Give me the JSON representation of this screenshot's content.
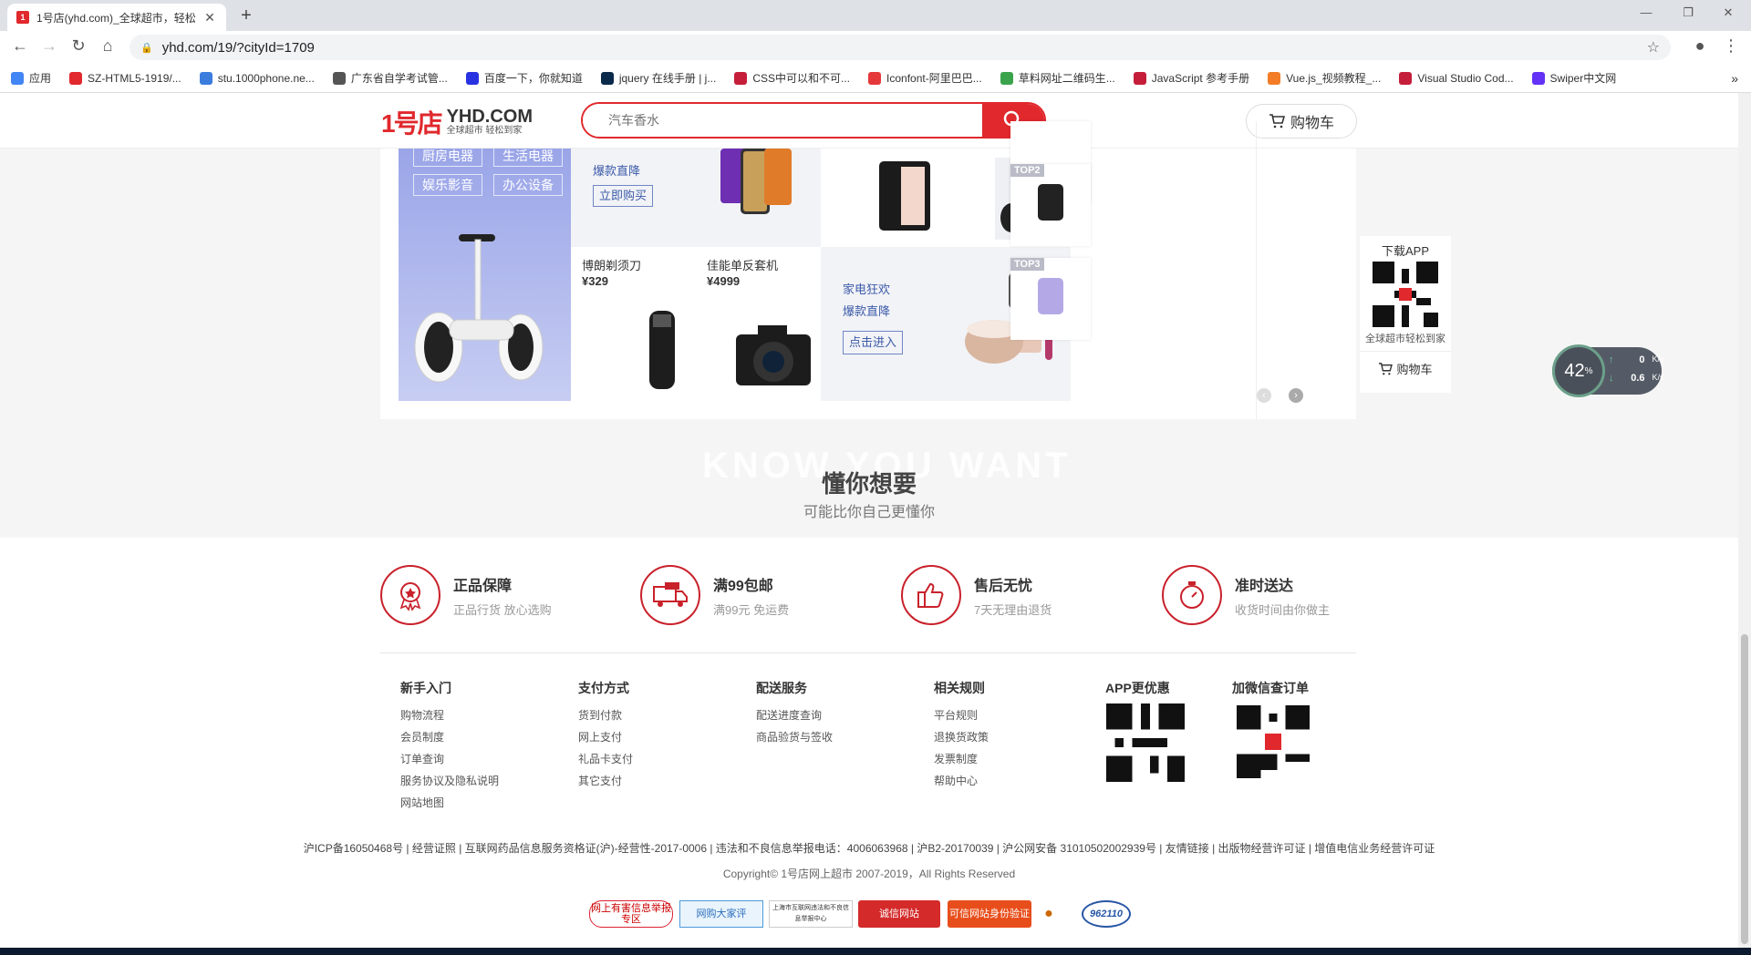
{
  "browser": {
    "tab_title": "1号店(yhd.com)_全球超市，轻松",
    "tab_favicon": "1",
    "url": "yhd.com/19/?cityId=1709",
    "bookmarks": [
      {
        "label": "应用",
        "color": "#4285f4"
      },
      {
        "label": "SZ-HTML5-1919/...",
        "color": "#e0282d"
      },
      {
        "label": "stu.1000phone.ne...",
        "color": "#3b7ddd"
      },
      {
        "label": "广东省自学考试管...",
        "color": "#555555"
      },
      {
        "label": "百度一下，你就知道",
        "color": "#2932e1"
      },
      {
        "label": "jquery 在线手册 | j...",
        "color": "#0b2a4a"
      },
      {
        "label": "CSS中可以和不可...",
        "color": "#c41e3a"
      },
      {
        "label": "Iconfont-阿里巴巴...",
        "color": "#e5383b"
      },
      {
        "label": "草料网址二维码生...",
        "color": "#3aa34c"
      },
      {
        "label": "JavaScript 参考手册",
        "color": "#c41e3a"
      },
      {
        "label": "Vue.js_视频教程_...",
        "color": "#f27d26"
      },
      {
        "label": "Visual Studio Cod...",
        "color": "#c41e3a"
      },
      {
        "label": "Swiper中文网",
        "color": "#6332f6"
      }
    ],
    "more_bookmarks": "»"
  },
  "header": {
    "logo_mark": "1号店",
    "logo_name": "YHD.COM",
    "logo_slogan": "全球超市 轻松到家",
    "search_placeholder": "汽车香水",
    "cart_label": "购物车",
    "brand_color": "#e0282d"
  },
  "promo": {
    "categories": [
      "厨房电器",
      "生活电器",
      "娱乐影音",
      "办公设备"
    ],
    "phone_promo": {
      "line": "爆款直降",
      "button": "立即购买"
    },
    "products": [
      {
        "name": "博朗剃须刀",
        "price": "¥329"
      },
      {
        "name": "佳能单反套机",
        "price": "¥4999"
      }
    ],
    "appliance_promo": {
      "line1": "家电狂欢",
      "line2": "爆款直降",
      "button": "点击进入"
    },
    "top_ranks": [
      "TOP2",
      "TOP3"
    ]
  },
  "side_app": {
    "title": "下载APP",
    "caption": "全球超市轻松到家",
    "cart_label": "购物车"
  },
  "net_widget": {
    "percent": "42",
    "percent_unit": "%",
    "up": "0",
    "down": "0.6",
    "unit": "K/s"
  },
  "know": {
    "bg_text": "KNOW YOU WANT",
    "title": "懂你想要",
    "subtitle": "可能比你自己更懂你"
  },
  "footer": {
    "features": [
      {
        "icon": "authentic-badge-icon",
        "title": "正品保障",
        "sub": "正品行货 放心选购"
      },
      {
        "icon": "free-shipping-truck-icon",
        "title": "满99包邮",
        "sub": "满99元 免运费"
      },
      {
        "icon": "thumbs-up-icon",
        "title": "售后无忧",
        "sub": "7天无理由退货"
      },
      {
        "icon": "timer-icon",
        "title": "准时送达",
        "sub": "收货时间由你做主"
      }
    ],
    "columns": [
      {
        "title": "新手入门",
        "links": [
          "购物流程",
          "会员制度",
          "订单查询",
          "服务协议及隐私说明",
          "网站地图"
        ]
      },
      {
        "title": "支付方式",
        "links": [
          "货到付款",
          "网上支付",
          "礼品卡支付",
          "其它支付"
        ]
      },
      {
        "title": "配送服务",
        "links": [
          "配送进度查询",
          "商品验货与签收"
        ]
      },
      {
        "title": "相关规则",
        "links": [
          "平台规则",
          "退换货政策",
          "发票制度",
          "帮助中心"
        ]
      }
    ],
    "qr_app_title": "APP更优惠",
    "qr_wechat_title": "加微信查订单",
    "icp": "沪ICP备16050468号 | 经营证照 | 互联网药品信息服务资格证(沪)-经营性-2017-0006 | 违法和不良信息举报电话：4006063968 | 沪B2-20170039 | 沪公网安备 31010502002939号 | 友情链接 | 出版物经营许可证 | 增值电信业务经营许可证",
    "copyright": "Copyright© 1号店网上超市 2007-2019，All Rights Reserved",
    "badges": [
      {
        "label": "网上有害信息举报专区"
      },
      {
        "label": "网购大家评"
      },
      {
        "label": "上海市互联网违法和不良信息举报中心"
      },
      {
        "label": "诚信网站"
      },
      {
        "label": "可信网站身份验证"
      },
      {
        "label": "962110"
      }
    ]
  }
}
